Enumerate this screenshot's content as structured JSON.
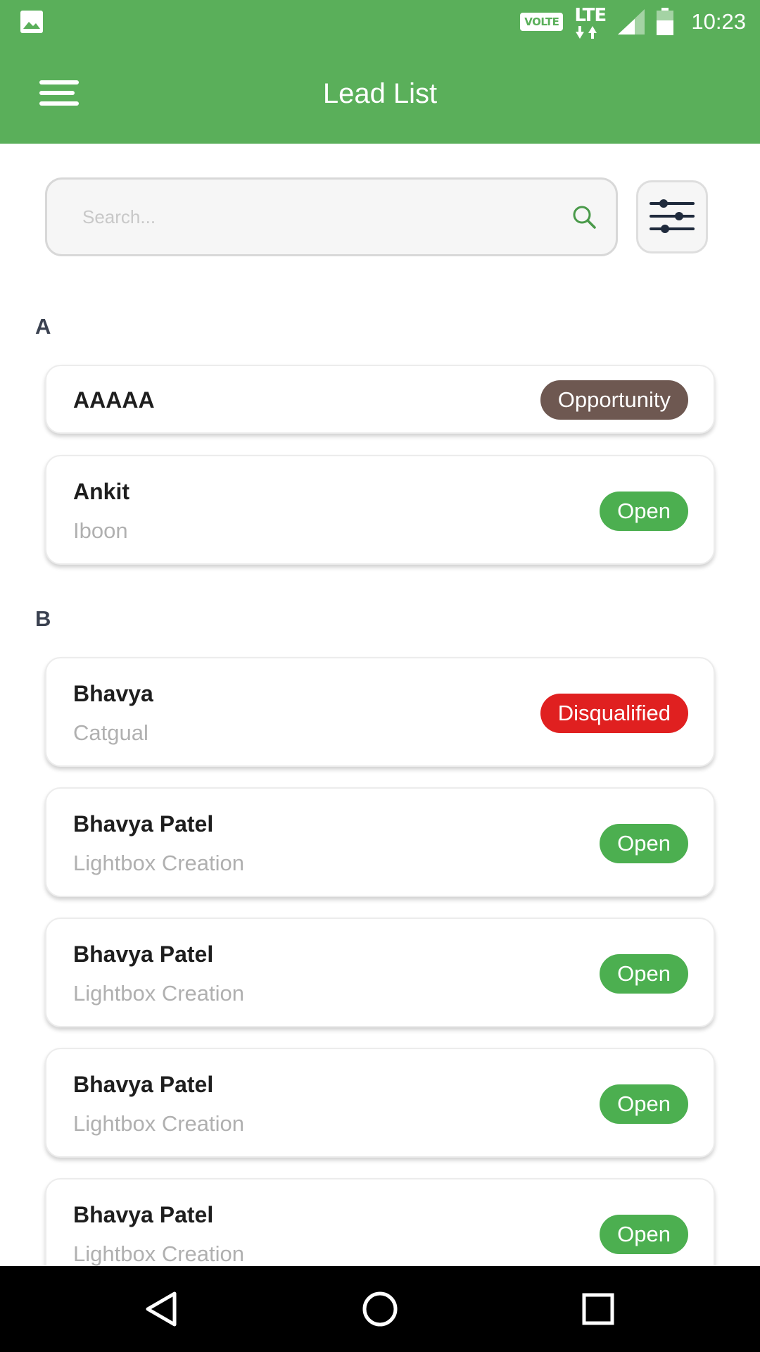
{
  "status_bar": {
    "volte": "VOLTE",
    "network": "LTE",
    "time": "10:23",
    "gallery_icon": "image-icon",
    "signal_icon": "signal-icon",
    "battery_icon": "battery-icon"
  },
  "app_bar": {
    "title": "Lead List",
    "menu_icon": "hamburger-menu-icon"
  },
  "search": {
    "placeholder": "Search...",
    "value": "",
    "icon": "search-icon"
  },
  "filter": {
    "icon": "sliders-icon"
  },
  "colors": {
    "primary": "#5aaf5a",
    "opportunity": "#6e5851",
    "open": "#4caf50",
    "disqualified": "#e02020"
  },
  "sections": [
    {
      "letter": "A",
      "leads": [
        {
          "name": "AAAAA",
          "company": "",
          "status": "Opportunity"
        },
        {
          "name": "Ankit",
          "company": "Iboon",
          "status": "Open"
        }
      ]
    },
    {
      "letter": "B",
      "leads": [
        {
          "name": "Bhavya",
          "company": "Catgual",
          "status": "Disqualified"
        },
        {
          "name": "Bhavya Patel",
          "company": "Lightbox Creation",
          "status": "Open"
        },
        {
          "name": "Bhavya Patel",
          "company": "Lightbox Creation",
          "status": "Open"
        },
        {
          "name": "Bhavya Patel",
          "company": "Lightbox Creation",
          "status": "Open"
        },
        {
          "name": "Bhavya Patel",
          "company": "Lightbox Creation",
          "status": "Open"
        }
      ]
    }
  ],
  "nav_bar": {
    "back_icon": "back-triangle-icon",
    "home_icon": "home-circle-icon",
    "recents_icon": "recents-square-icon"
  }
}
